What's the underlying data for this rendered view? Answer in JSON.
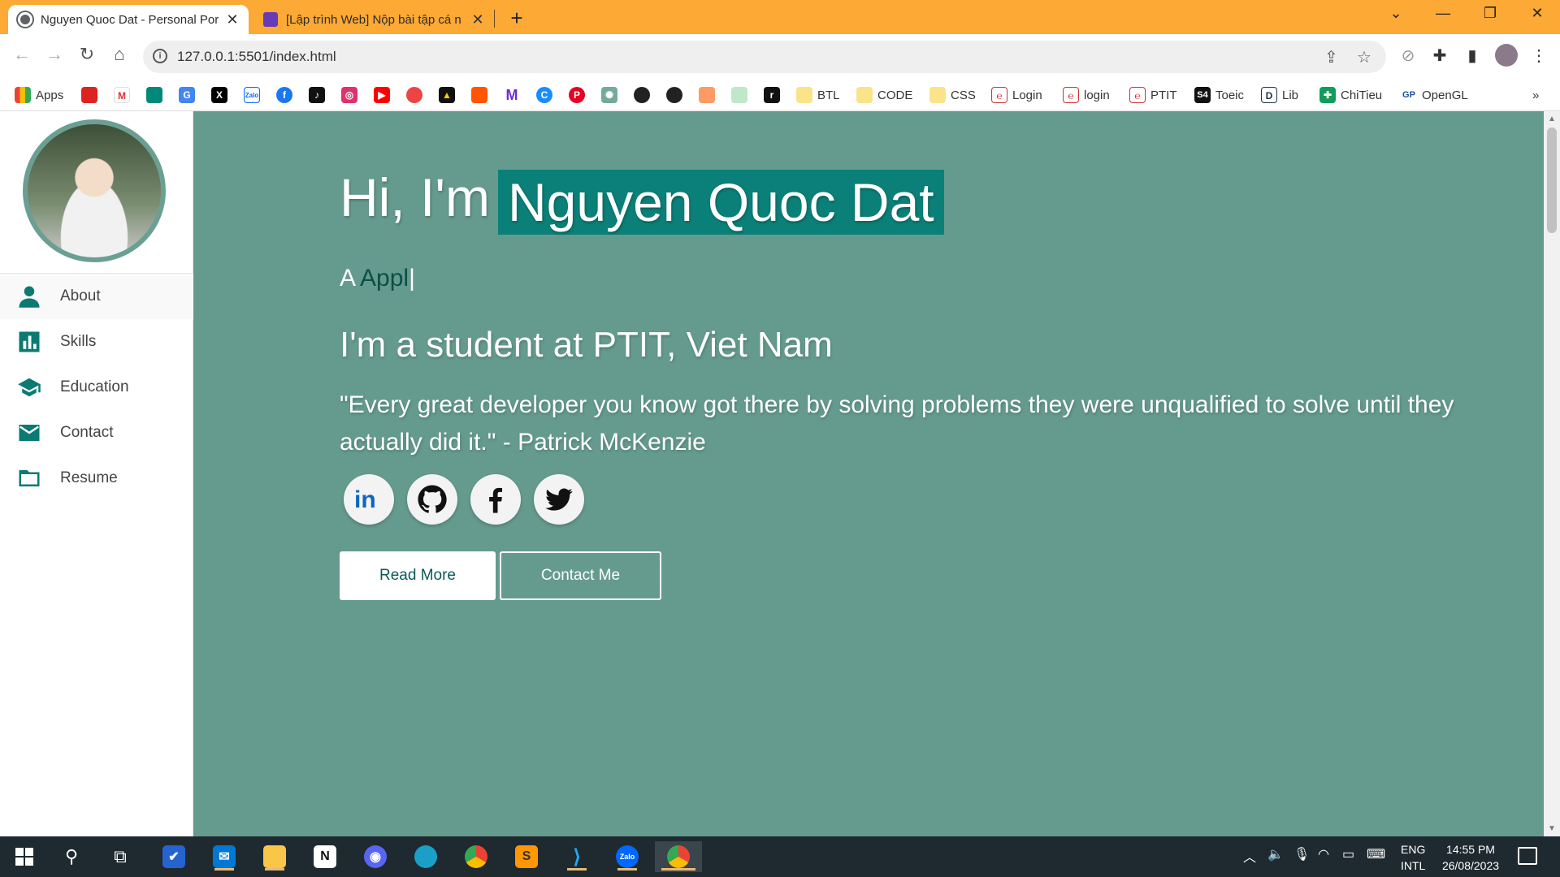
{
  "browser": {
    "tabs": [
      {
        "title": "Nguyen Quoc Dat - Personal Por",
        "active": true
      },
      {
        "title": "[Lập trình Web] Nộp bài tập cá n",
        "active": false
      }
    ],
    "new_tab": "+",
    "url": "127.0.0.1:5501/index.html",
    "bookmarks": [
      {
        "label": "Apps",
        "icon": "apps-grid-icon"
      },
      {
        "label": "",
        "icon": "huawei-icon"
      },
      {
        "label": "",
        "icon": "gmail-icon"
      },
      {
        "label": "",
        "icon": "google-meet-icon"
      },
      {
        "label": "",
        "icon": "google-translate-icon"
      },
      {
        "label": "",
        "icon": "x-icon"
      },
      {
        "label": "",
        "icon": "zalo-icon"
      },
      {
        "label": "",
        "icon": "facebook-icon"
      },
      {
        "label": "",
        "icon": "tiktok-icon"
      },
      {
        "label": "",
        "icon": "instagram-icon"
      },
      {
        "label": "",
        "icon": "youtube-icon"
      },
      {
        "label": "",
        "icon": "chrome-app-icon"
      },
      {
        "label": "",
        "icon": "google-drive-icon"
      },
      {
        "label": "",
        "icon": "soundcloud-icon"
      },
      {
        "label": "",
        "icon": "medium-icon"
      },
      {
        "label": "",
        "icon": "coccoc-icon"
      },
      {
        "label": "",
        "icon": "pinterest-icon"
      },
      {
        "label": "",
        "icon": "chatgpt-icon"
      },
      {
        "label": "",
        "icon": "github-icon"
      },
      {
        "label": "",
        "icon": "github-icon"
      },
      {
        "label": "",
        "icon": "figma-icon"
      },
      {
        "label": "",
        "icon": "app-icon"
      },
      {
        "label": "",
        "icon": "rapid-icon"
      },
      {
        "label": "BTL",
        "icon": "folder-icon"
      },
      {
        "label": "CODE",
        "icon": "folder-icon"
      },
      {
        "label": "CSS",
        "icon": "folder-icon"
      },
      {
        "label": "Login",
        "icon": "login-icon"
      },
      {
        "label": "login",
        "icon": "login-icon"
      },
      {
        "label": "PTIT",
        "icon": "ptit-icon"
      },
      {
        "label": "Toeic",
        "icon": "toeic-icon"
      },
      {
        "label": "Lib",
        "icon": "lib-icon"
      },
      {
        "label": "ChiTieu",
        "icon": "sheets-icon"
      },
      {
        "label": "OpenGL",
        "icon": "opengl-icon"
      }
    ],
    "bm_s4": "S4",
    "bm_more": "»"
  },
  "sidebar": {
    "items": [
      {
        "label": "About",
        "icon": "person-icon"
      },
      {
        "label": "Skills",
        "icon": "bar-chart-icon"
      },
      {
        "label": "Education",
        "icon": "graduation-cap-icon"
      },
      {
        "label": "Contact",
        "icon": "envelope-icon"
      },
      {
        "label": "Resume",
        "icon": "folder-icon"
      }
    ]
  },
  "hero": {
    "greeting": "Hi, I'm",
    "name": "Nguyen Quoc Dat",
    "typed_prefix": "A ",
    "typed_word": "Appl",
    "typed_cursor": "|",
    "student": "I'm a student at PTIT, Viet Nam",
    "quote": "\"Every great developer you know got there by solving problems they were unqualified to solve until they actually did it.\" - Patrick McKenzie",
    "social": [
      {
        "name": "linkedin",
        "icon": "linkedin-icon"
      },
      {
        "name": "github",
        "icon": "github-icon"
      },
      {
        "name": "facebook",
        "icon": "facebook-icon"
      },
      {
        "name": "twitter",
        "icon": "twitter-icon"
      }
    ],
    "btn_read_more": "Read More",
    "btn_contact": "Contact Me"
  },
  "taskbar": {
    "lang_1": "ENG",
    "lang_2": "INTL",
    "time": "14:55 PM",
    "date": "26/08/2023"
  },
  "colors": {
    "accent": "#0b8078",
    "hero_bg": "#659b8e",
    "chrome_frame": "#fca935"
  }
}
